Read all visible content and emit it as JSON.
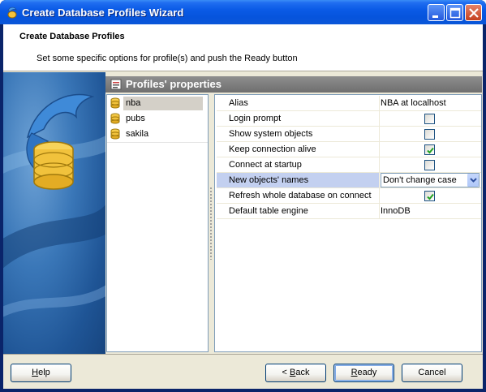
{
  "window": {
    "title": "Create Database Profiles Wizard"
  },
  "header": {
    "title": "Create Database Profiles",
    "subtitle": "Set some specific options for profile(s) and push the Ready button"
  },
  "panel": {
    "title": "Profiles' properties"
  },
  "profiles": [
    {
      "label": "nba",
      "selected": true
    },
    {
      "label": "pubs",
      "selected": false
    },
    {
      "label": "sakila",
      "selected": false
    }
  ],
  "properties": [
    {
      "name": "Alias",
      "type": "text",
      "value": "NBA at localhost"
    },
    {
      "name": "Login prompt",
      "type": "checkbox",
      "checked": false
    },
    {
      "name": "Show system objects",
      "type": "checkbox",
      "checked": false
    },
    {
      "name": "Keep connection alive",
      "type": "checkbox",
      "checked": true
    },
    {
      "name": "Connect at startup",
      "type": "checkbox",
      "checked": false
    },
    {
      "name": "New objects' names",
      "type": "select",
      "value": "Don't change case",
      "selected": true
    },
    {
      "name": "Refresh whole database on connect",
      "type": "checkbox",
      "checked": true
    },
    {
      "name": "Default table engine",
      "type": "text",
      "value": "InnoDB"
    }
  ],
  "buttons": {
    "help": {
      "pre": "",
      "accel": "H",
      "post": "elp"
    },
    "back": {
      "pre": "< ",
      "accel": "B",
      "post": "ack"
    },
    "ready": {
      "pre": "",
      "accel": "R",
      "post": "eady"
    },
    "cancel": {
      "pre": "Cancel",
      "accel": "",
      "post": ""
    }
  },
  "icons": {
    "app": "dolphin-db-icon",
    "panel": "properties-icon",
    "profile": "database-icon",
    "check": "checkmark-icon",
    "dropdown": "chevron-down-icon"
  },
  "colors": {
    "title_bar": "#0a5ae6",
    "check": "#21a121",
    "selection": "#c3d0f0"
  }
}
